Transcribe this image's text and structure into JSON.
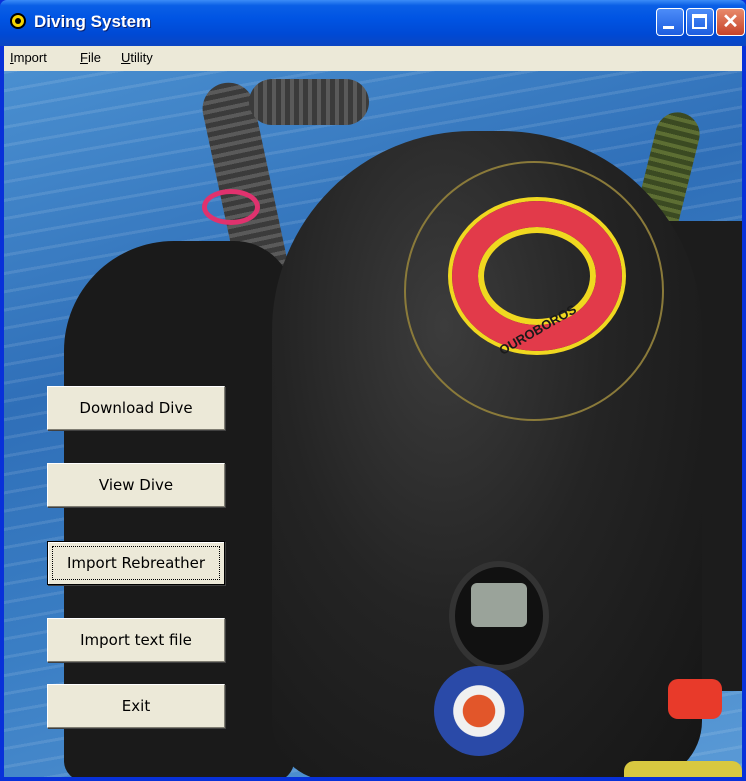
{
  "window": {
    "title": "Diving System",
    "controls": {
      "minimize": "minimize-icon",
      "maximize": "maximize-icon",
      "close": "close-icon"
    }
  },
  "menubar": {
    "items": [
      {
        "label": "mport",
        "mnemonic": "I"
      },
      {
        "label": "ile",
        "mnemonic": "F"
      },
      {
        "label": "tility",
        "mnemonic": "U"
      }
    ]
  },
  "buttons": {
    "download": "Download Dive",
    "view": "View Dive",
    "import_rebreather": "Import Rebreather",
    "import_text": "Import text file",
    "exit": "Exit"
  },
  "background_image": {
    "logo_text": "OUROBOROS"
  },
  "colors": {
    "titlebar": "#0054e3",
    "button_face": "#ece9d8",
    "logo_red": "#e23a4a",
    "logo_yellow": "#f0d820"
  }
}
